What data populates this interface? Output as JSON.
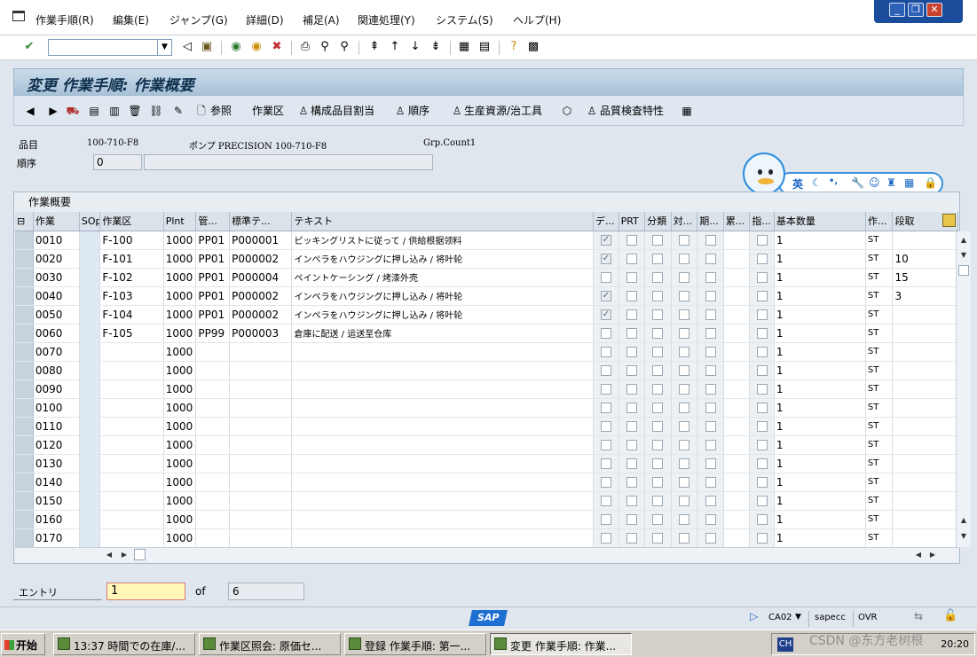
{
  "menu": [
    "作業手順(R)",
    "編集(E)",
    "ジャンプ(G)",
    "詳細(D)",
    "補足(A)",
    "関連処理(Y)",
    "システム(S)",
    "ヘルプ(H)"
  ],
  "window_controls": {
    "minimize": "_",
    "maximize": "❐",
    "close": "✕"
  },
  "title": "変更 作業手順: 作業概要",
  "app_toolbar": {
    "ref_label": "参照",
    "work_center_label": "作業区",
    "component_alloc_label": "構成品目割当",
    "sequence_label": "順序",
    "prt_label": "生産資源/治工具",
    "inspection_label": "品質検査特性"
  },
  "header": {
    "material_label": "品目",
    "material_value": "100-710-F8",
    "material_desc": "ポンプ PRECISION 100-710-F8",
    "grp_count": "Grp.Count1",
    "sequence_label": "順序",
    "sequence_value": "0"
  },
  "ime": {
    "lang": "英",
    "moon": "☾",
    "punct": "•,"
  },
  "table": {
    "title": "作業概要",
    "headers": {
      "select": "⊟",
      "op": "作業",
      "sop": "SOp",
      "wc": "作業区",
      "plnt": "Plnt",
      "ctrl": "管...",
      "stdtxt": "標準テ...",
      "text": "テキスト",
      "d": "デ...",
      "prt": "PRT",
      "split": "分類",
      "tgt": "対...",
      "period": "期...",
      "cum": "累...",
      "ind": "指...",
      "base_qty": "基本数量",
      "unit": "作...",
      "setup": "段取"
    },
    "rows": [
      {
        "op": "0010",
        "wc": "F-100",
        "plnt": "1000",
        "ctrl": "PP01",
        "stdtxt": "P000001",
        "text": "ピッキングリストに従って / 供給根据领料",
        "d": true,
        "qty": "1",
        "unit": "ST",
        "setup": ""
      },
      {
        "op": "0020",
        "wc": "F-101",
        "plnt": "1000",
        "ctrl": "PP01",
        "stdtxt": "P000002",
        "text": "インペラをハウジングに押し込み / 将叶轮",
        "d": true,
        "qty": "1",
        "unit": "ST",
        "setup": "10"
      },
      {
        "op": "0030",
        "wc": "F-102",
        "plnt": "1000",
        "ctrl": "PP01",
        "stdtxt": "P000004",
        "text": "ペイントケーシング / 烤漆外壳",
        "d": false,
        "qty": "1",
        "unit": "ST",
        "setup": "15"
      },
      {
        "op": "0040",
        "wc": "F-103",
        "plnt": "1000",
        "ctrl": "PP01",
        "stdtxt": "P000002",
        "text": "インペラをハウジングに押し込み / 将叶轮",
        "d": true,
        "qty": "1",
        "unit": "ST",
        "setup": "3"
      },
      {
        "op": "0050",
        "wc": "F-104",
        "plnt": "1000",
        "ctrl": "PP01",
        "stdtxt": "P000002",
        "text": "インペラをハウジングに押し込み / 将叶轮",
        "d": true,
        "qty": "1",
        "unit": "ST",
        "setup": ""
      },
      {
        "op": "0060",
        "wc": "F-105",
        "plnt": "1000",
        "ctrl": "PP99",
        "stdtxt": "P000003",
        "text": "倉庫に配送 / 运送至仓库",
        "d": false,
        "qty": "1",
        "unit": "ST",
        "setup": ""
      },
      {
        "op": "0070",
        "wc": "",
        "plnt": "1000",
        "ctrl": "",
        "stdtxt": "",
        "text": "",
        "d": false,
        "qty": "1",
        "unit": "ST",
        "setup": ""
      },
      {
        "op": "0080",
        "wc": "",
        "plnt": "1000",
        "ctrl": "",
        "stdtxt": "",
        "text": "",
        "d": false,
        "qty": "1",
        "unit": "ST",
        "setup": ""
      },
      {
        "op": "0090",
        "wc": "",
        "plnt": "1000",
        "ctrl": "",
        "stdtxt": "",
        "text": "",
        "d": false,
        "qty": "1",
        "unit": "ST",
        "setup": ""
      },
      {
        "op": "0100",
        "wc": "",
        "plnt": "1000",
        "ctrl": "",
        "stdtxt": "",
        "text": "",
        "d": false,
        "qty": "1",
        "unit": "ST",
        "setup": ""
      },
      {
        "op": "0110",
        "wc": "",
        "plnt": "1000",
        "ctrl": "",
        "stdtxt": "",
        "text": "",
        "d": false,
        "qty": "1",
        "unit": "ST",
        "setup": ""
      },
      {
        "op": "0120",
        "wc": "",
        "plnt": "1000",
        "ctrl": "",
        "stdtxt": "",
        "text": "",
        "d": false,
        "qty": "1",
        "unit": "ST",
        "setup": ""
      },
      {
        "op": "0130",
        "wc": "",
        "plnt": "1000",
        "ctrl": "",
        "stdtxt": "",
        "text": "",
        "d": false,
        "qty": "1",
        "unit": "ST",
        "setup": ""
      },
      {
        "op": "0140",
        "wc": "",
        "plnt": "1000",
        "ctrl": "",
        "stdtxt": "",
        "text": "",
        "d": false,
        "qty": "1",
        "unit": "ST",
        "setup": ""
      },
      {
        "op": "0150",
        "wc": "",
        "plnt": "1000",
        "ctrl": "",
        "stdtxt": "",
        "text": "",
        "d": false,
        "qty": "1",
        "unit": "ST",
        "setup": ""
      },
      {
        "op": "0160",
        "wc": "",
        "plnt": "1000",
        "ctrl": "",
        "stdtxt": "",
        "text": "",
        "d": false,
        "qty": "1",
        "unit": "ST",
        "setup": ""
      },
      {
        "op": "0170",
        "wc": "",
        "plnt": "1000",
        "ctrl": "",
        "stdtxt": "",
        "text": "",
        "d": false,
        "qty": "1",
        "unit": "ST",
        "setup": ""
      }
    ]
  },
  "paging": {
    "entry_label": "エントリ",
    "entry_value": "1",
    "of_label": "of",
    "total": "6"
  },
  "status": {
    "tcode": "CA02",
    "server": "sapecc",
    "mode": "OVR",
    "logo": "SAP"
  },
  "taskbar": {
    "start": "开始",
    "tasks": [
      "13:37 時間での在庫/...",
      "作業区照会: 原価セ...",
      "登録 作業手順: 第一...",
      "変更 作業手順: 作業..."
    ],
    "lang": "CH",
    "clock": "20:20"
  },
  "watermark": "CSDN @东方老树根",
  "colors": {
    "title_bar": "#a8c2d8",
    "entry_field": "#fff6b8",
    "sap_blue": "#1d6fd1"
  }
}
